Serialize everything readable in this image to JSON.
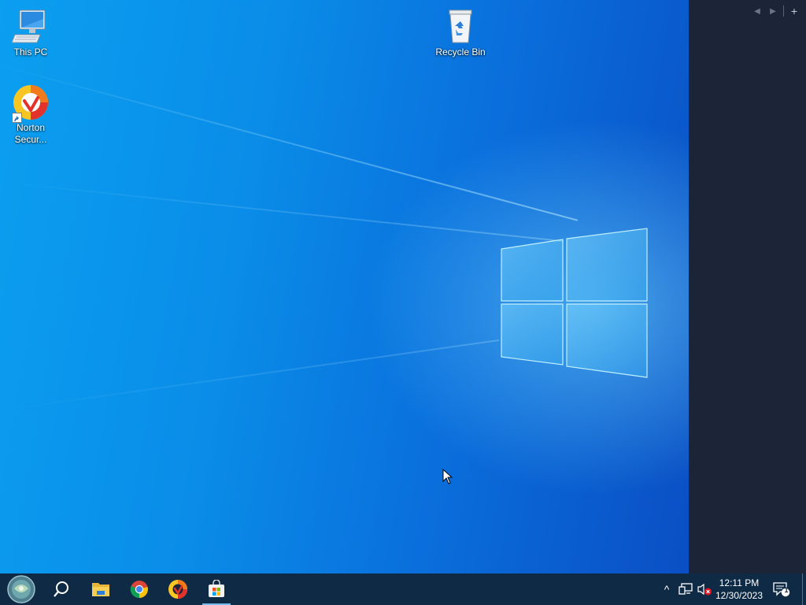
{
  "desktop": {
    "icons": [
      {
        "label": "This PC",
        "icon": "this-pc-icon"
      },
      {
        "label": "Recycle Bin",
        "icon": "recycle-bin-icon"
      },
      {
        "label_line1": "Norton",
        "label_line2": "Secur...",
        "icon": "norton-security-icon"
      }
    ]
  },
  "side_panel": {
    "prev_glyph": "◀",
    "next_glyph": "▶",
    "add_glyph": "+"
  },
  "taskbar": {
    "start_icon": "start-orb-icon",
    "search_icon": "search-icon",
    "pinned": [
      "file-explorer-icon",
      "chrome-icon",
      "norton-icon",
      "microsoft-store-icon"
    ],
    "tray": {
      "overflow_glyph": "^",
      "icons": [
        "network-icon",
        "volume-muted-icon"
      ],
      "time": "12:11 PM",
      "date": "12/30/2023",
      "notification_count": "1"
    }
  },
  "colors": {
    "taskbar_bg": "#0f2a44",
    "side_panel_bg": "#1c2538",
    "active_indicator": "#76b9ed"
  }
}
